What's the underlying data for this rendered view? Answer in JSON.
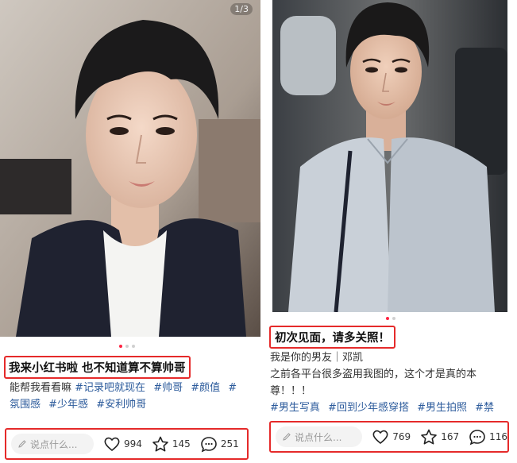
{
  "left_post": {
    "page_indicator": "1/3",
    "title": "我来小红书啦 也不知道算不算帅哥",
    "body_lines": [
      [
        {
          "text": "能帮我看看嘛",
          "tag": false
        },
        {
          "text": "#记录吧就现在",
          "tag": true
        },
        {
          "text": "#帅哥",
          "tag": true
        },
        {
          "text": "#颜值",
          "tag": true
        },
        {
          "text": "#",
          "tag": true
        }
      ],
      [
        {
          "text": "氛围感",
          "tag": true
        },
        {
          "text": "#少年感",
          "tag": true
        },
        {
          "text": "#安利帅哥",
          "tag": true
        }
      ]
    ],
    "comment_placeholder": "说点什么...",
    "likes": "994",
    "favorites": "145",
    "comments": "251"
  },
  "right_post": {
    "title": "初次见面，请多关照！",
    "body_lines": [
      [
        {
          "text": "我是你的男友｜邓凯",
          "tag": false
        }
      ],
      [
        {
          "text": "之前各平台很多盗用我图的，这个才是真的本",
          "tag": false
        }
      ],
      [
        {
          "text": "尊！！！",
          "tag": false
        }
      ],
      [
        {
          "text": "#男生写真",
          "tag": true
        },
        {
          "text": "#回到少年感穿搭",
          "tag": true
        },
        {
          "text": "#男生拍照",
          "tag": true
        },
        {
          "text": "#禁",
          "tag": true
        }
      ]
    ],
    "comment_placeholder": "说点什么...",
    "likes": "769",
    "favorites": "167",
    "comments": "116"
  },
  "colors": {
    "highlight_box": "#e52a2a",
    "hashtag": "#2b5a9b",
    "active_dot": "#ff2442"
  }
}
